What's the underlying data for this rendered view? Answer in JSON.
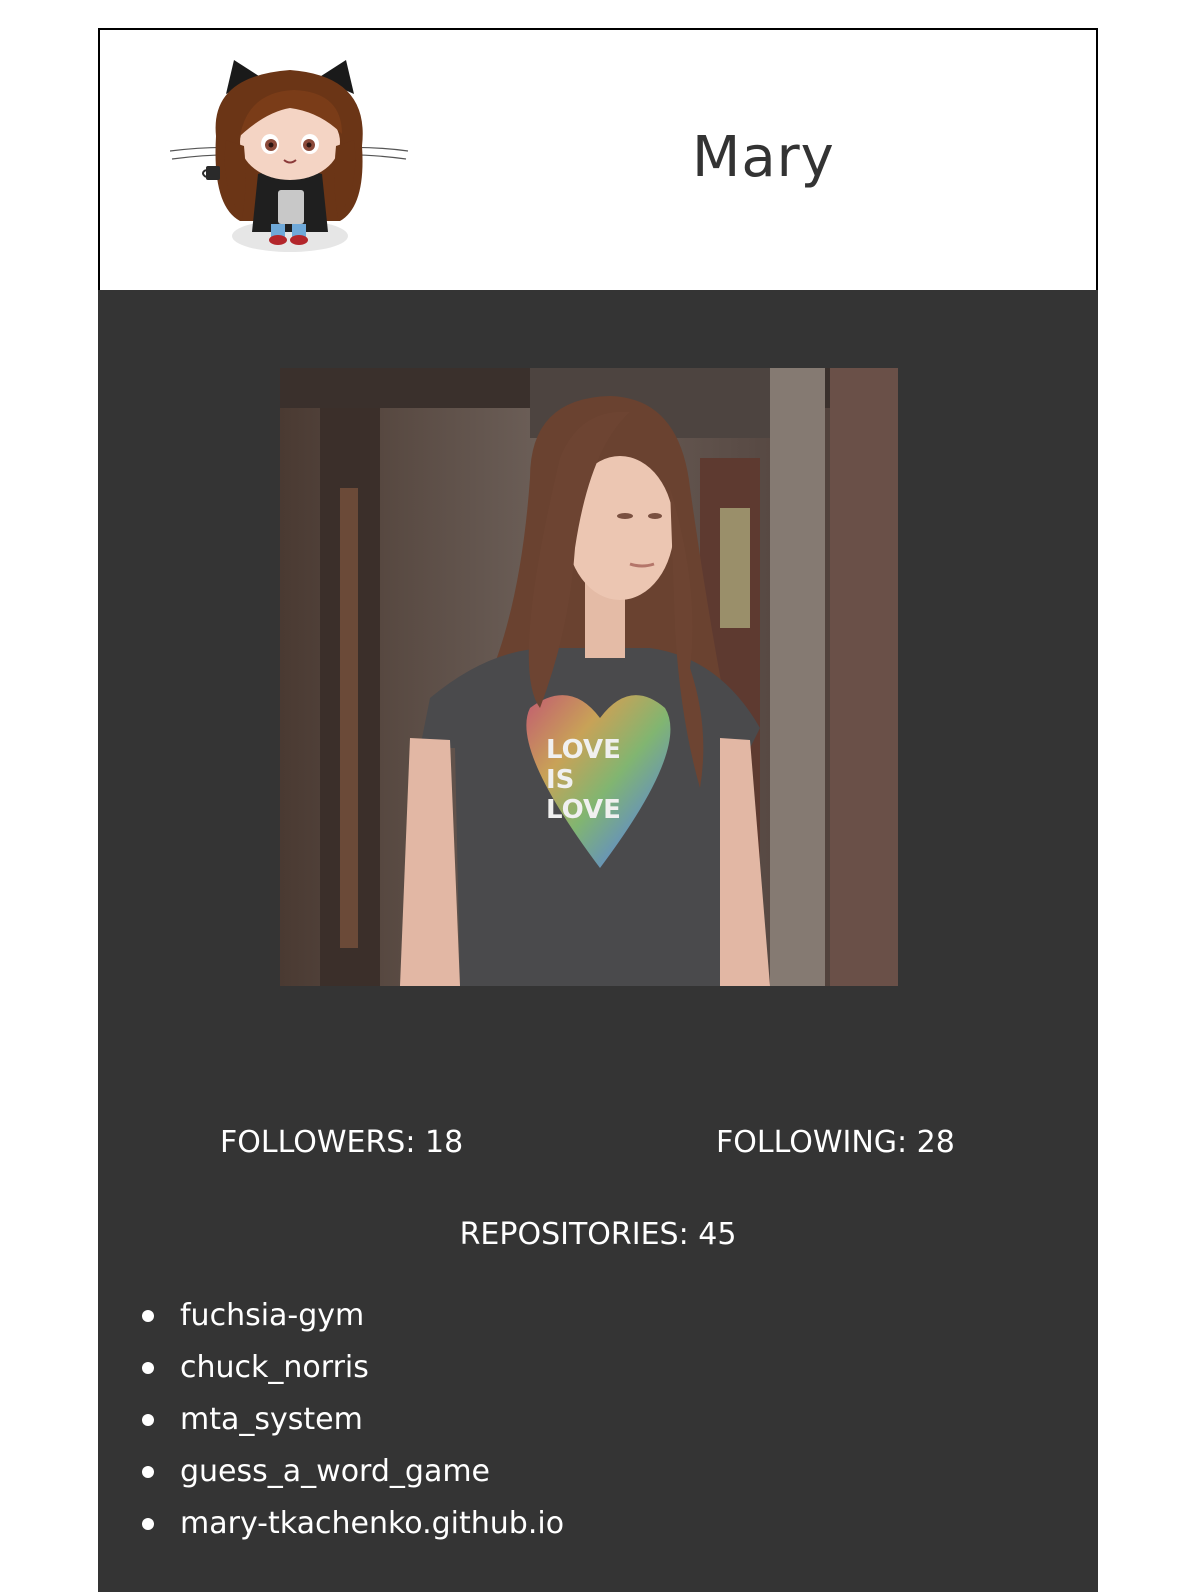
{
  "profile": {
    "name": "Mary",
    "followers_label": "FOLLOWERS: 18",
    "following_label": "FOLLOWING: 28",
    "repositories_label": "REPOSITORIES: 45"
  },
  "repositories": [
    "fuchsia-gym",
    "chuck_norris",
    "mta_system",
    "guess_a_word_game",
    "mary-tkachenko.github.io"
  ],
  "shirt_text": [
    "LOVE",
    "IS",
    "LOVE"
  ],
  "colors": {
    "panel": "#343434",
    "text_on_panel": "#ffffff",
    "header_text": "#333333"
  }
}
